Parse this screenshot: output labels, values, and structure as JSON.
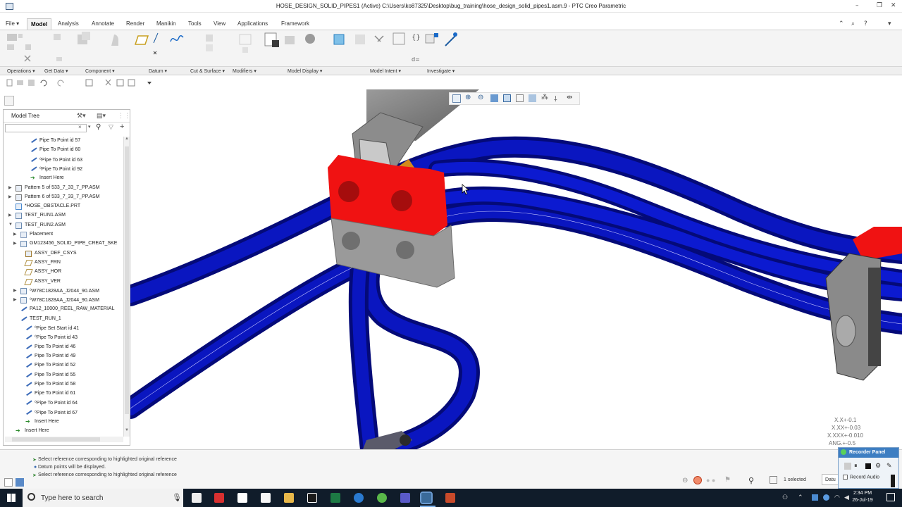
{
  "window": {
    "title": "HOSE_DESIGN_SOLID_PIPES1 (Active) C:\\Users\\ko87325\\Desktop\\bug_training\\hose_design_solid_pipes1.asm.9 - PTC Creo Parametric"
  },
  "menu": [
    {
      "label": "File ▾",
      "active": false
    },
    {
      "label": "Model",
      "active": true
    },
    {
      "label": "Analysis",
      "active": false
    },
    {
      "label": "Annotate",
      "active": false
    },
    {
      "label": "Render",
      "active": false
    },
    {
      "label": "Manikin",
      "active": false
    },
    {
      "label": "Tools",
      "active": false
    },
    {
      "label": "View",
      "active": false
    },
    {
      "label": "Applications",
      "active": false
    },
    {
      "label": "Framework",
      "active": false
    }
  ],
  "ribbon_groups": [
    "Operations ▾",
    "Get Data ▾",
    "Component ▾",
    "Datum ▾",
    "Cut & Surface ▾",
    "Modifiers ▾",
    "Model Display ▾",
    "Model Intent ▾",
    "Investigate ▾"
  ],
  "model_tree": {
    "title": "Model Tree",
    "search_placeholder": "",
    "items": [
      {
        "label": "Pipe To Point id 57",
        "icon": "pipe-icon",
        "expander": ""
      },
      {
        "label": "Pipe To Point id 60",
        "icon": "pipe-icon",
        "expander": ""
      },
      {
        "label": "⁰Pipe To Point id 63",
        "icon": "pipe-icon",
        "expander": ""
      },
      {
        "label": "⁰Pipe To Point id 92",
        "icon": "pipe-icon",
        "expander": ""
      },
      {
        "label": "Insert Here",
        "icon": "insert-arrow-icon",
        "expander": ""
      },
      {
        "label": "Pattern 5 of 533_7_33_7_PP.ASM",
        "icon": "pattern-icon",
        "expander": "▶"
      },
      {
        "label": "Pattern 6 of 533_7_33_7_PP.ASM",
        "icon": "pattern-icon",
        "expander": "▶"
      },
      {
        "label": "*HOSE_OBSTACLE.PRT",
        "icon": "part-icon",
        "expander": ""
      },
      {
        "label": "TEST_RUN1.ASM",
        "icon": "assembly-icon",
        "expander": "▶"
      },
      {
        "label": "TEST_RUN2.ASM",
        "icon": "assembly-icon",
        "expander": "▼"
      },
      {
        "label": "Placement",
        "icon": "placement-icon",
        "expander": "▶"
      },
      {
        "label": "GM123456_SOLID_PIPE_CREAT_SKE",
        "icon": "assembly-icon",
        "expander": "▶"
      },
      {
        "label": "ASSY_DEF_CSYS",
        "icon": "csys-icon",
        "expander": ""
      },
      {
        "label": "ASSY_FRN",
        "icon": "datum-plane-icon",
        "expander": ""
      },
      {
        "label": "ASSY_HOR",
        "icon": "datum-plane-icon",
        "expander": ""
      },
      {
        "label": "ASSY_VER",
        "icon": "datum-plane-icon",
        "expander": ""
      },
      {
        "label": "⁰W78C1828AA_J2044_90.ASM",
        "icon": "assembly-icon",
        "expander": "▶"
      },
      {
        "label": "⁰W78C1828AA_J2044_90.ASM",
        "icon": "assembly-icon",
        "expander": "▶"
      },
      {
        "label": "PA12_10000_REEL_RAW_MATERIAL",
        "icon": "pipe-icon",
        "expander": ""
      },
      {
        "label": "TEST_RUN_1",
        "icon": "pipe-icon",
        "expander": ""
      },
      {
        "label": "⁰Pipe Set Start id 41",
        "icon": "pipe-icon",
        "expander": ""
      },
      {
        "label": "⁰Pipe To Point id 43",
        "icon": "pipe-icon",
        "expander": ""
      },
      {
        "label": "Pipe To Point id 46",
        "icon": "pipe-icon",
        "expander": ""
      },
      {
        "label": "Pipe To Point id 49",
        "icon": "pipe-icon",
        "expander": ""
      },
      {
        "label": "Pipe To Point id 52",
        "icon": "pipe-icon",
        "expander": ""
      },
      {
        "label": "Pipe To Point id 55",
        "icon": "pipe-icon",
        "expander": ""
      },
      {
        "label": "Pipe To Point id 58",
        "icon": "pipe-icon",
        "expander": ""
      },
      {
        "label": "Pipe To Point id 61",
        "icon": "pipe-icon",
        "expander": ""
      },
      {
        "label": "⁰Pipe To Point id 64",
        "icon": "pipe-icon",
        "expander": ""
      },
      {
        "label": "⁰Pipe To Point id 67",
        "icon": "pipe-icon",
        "expander": ""
      },
      {
        "label": "Insert Here",
        "icon": "insert-arrow-icon",
        "expander": ""
      },
      {
        "label": "Insert Here",
        "icon": "insert-arrow-icon",
        "expander": ""
      }
    ]
  },
  "tolerances": [
    "X.X+-0.1",
    "X.XX+-0.03",
    "X.XXX+-0.010",
    "ANG.+-0.5"
  ],
  "status_messages": [
    "Select reference corresponding to highlighted original reference",
    "Datum points will be displayed.",
    "Select reference corresponding to highlighted original reference"
  ],
  "status_right": {
    "selected": "1 selected",
    "filter": "Datu"
  },
  "recorder": {
    "title": "Recorder Panel",
    "record_audio": "Record Audio"
  },
  "taskbar": {
    "search_placeholder": "Type here to search",
    "time": "2:34 PM",
    "date": "26-Jul-19"
  },
  "colors": {
    "pipe": "#0a14b8",
    "clamp_red": "#ee1111",
    "clamp_grey": "#9a9a9a",
    "accent": "#2b579a"
  }
}
